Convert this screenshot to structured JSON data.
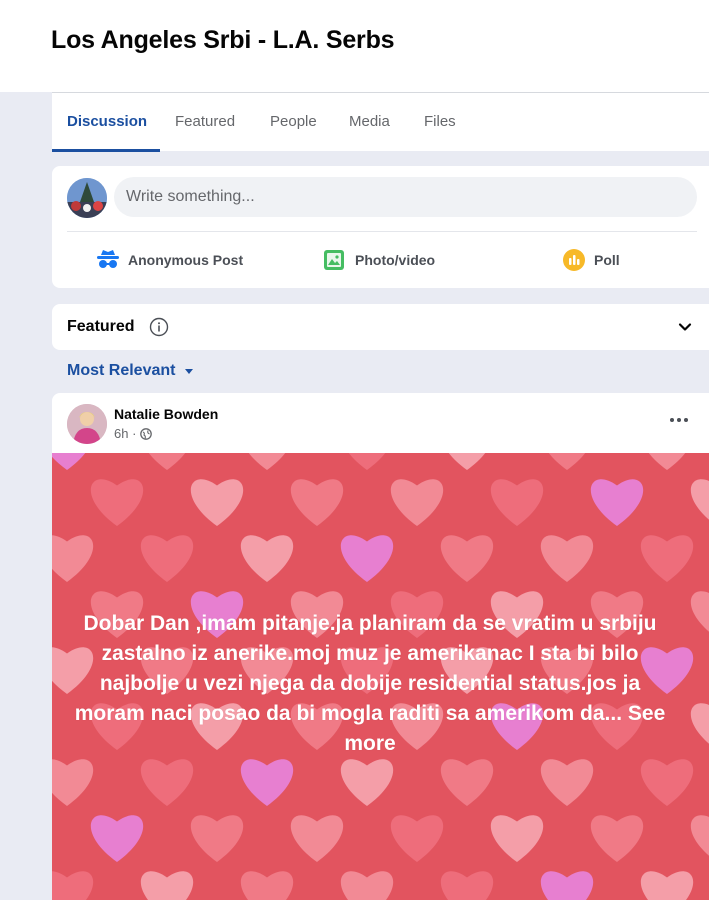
{
  "group": {
    "title": "Los Angeles Srbi - L.A. Serbs"
  },
  "tabs": [
    {
      "label": "Discussion",
      "active": true
    },
    {
      "label": "Featured",
      "active": false
    },
    {
      "label": "People",
      "active": false
    },
    {
      "label": "Media",
      "active": false
    },
    {
      "label": "Files",
      "active": false
    }
  ],
  "composer": {
    "placeholder": "Write something...",
    "actions": [
      {
        "label": "Anonymous Post",
        "icon": "anonymous-icon",
        "color": "#1877f2"
      },
      {
        "label": "Photo/video",
        "icon": "photo-video-icon",
        "color": "#45bd62"
      },
      {
        "label": "Poll",
        "icon": "poll-icon",
        "color": "#f7b928"
      }
    ]
  },
  "featured": {
    "label": "Featured"
  },
  "sort": {
    "label": "Most Relevant"
  },
  "post": {
    "author": "Natalie Bowden",
    "time": "6h ·",
    "text": "Dobar Dan ,imam pitanje.ja planiram da se vratim u srbiju zastalno iz anerike.moj muz je amerikanac I sta bi bilo najbolje u vezi njega da dobije residential status.jos ja moram naci posao da bi mogla raditi sa amerikom da...",
    "see_more": "See more",
    "background_color": "#e2545f"
  },
  "colors": {
    "accent": "#1b4fa0",
    "page_bg": "#e9ebf3"
  }
}
